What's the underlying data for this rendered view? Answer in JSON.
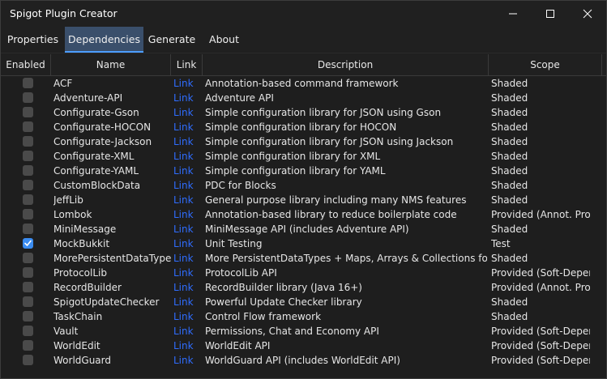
{
  "window": {
    "title": "Spigot Plugin Creator",
    "controls": [
      "minimize",
      "maximize",
      "close"
    ]
  },
  "tabs": [
    {
      "label": "Properties",
      "active": false
    },
    {
      "label": "Dependencies",
      "active": true
    },
    {
      "label": "Generate",
      "active": false
    },
    {
      "label": "About",
      "active": false
    }
  ],
  "table": {
    "columns": {
      "enabled": "Enabled",
      "name": "Name",
      "link": "Link",
      "description": "Description",
      "scope": "Scope"
    },
    "rows": [
      {
        "enabled": false,
        "name": "ACF",
        "link": "Link",
        "description": "Annotation-based command framework",
        "scope": "Shaded"
      },
      {
        "enabled": false,
        "name": "Adventure-API",
        "link": "Link",
        "description": "Adventure API",
        "scope": "Shaded"
      },
      {
        "enabled": false,
        "name": "Configurate-Gson",
        "link": "Link",
        "description": "Simple configuration library for JSON using Gson",
        "scope": "Shaded"
      },
      {
        "enabled": false,
        "name": "Configurate-HOCON",
        "link": "Link",
        "description": "Simple configuration library for HOCON",
        "scope": "Shaded"
      },
      {
        "enabled": false,
        "name": "Configurate-Jackson",
        "link": "Link",
        "description": "Simple configuration library for JSON using Jackson",
        "scope": "Shaded"
      },
      {
        "enabled": false,
        "name": "Configurate-XML",
        "link": "Link",
        "description": "Simple configuration library for XML",
        "scope": "Shaded"
      },
      {
        "enabled": false,
        "name": "Configurate-YAML",
        "link": "Link",
        "description": "Simple configuration library for YAML",
        "scope": "Shaded"
      },
      {
        "enabled": false,
        "name": "CustomBlockData",
        "link": "Link",
        "description": "PDC for Blocks",
        "scope": "Shaded"
      },
      {
        "enabled": false,
        "name": "JeffLib",
        "link": "Link",
        "description": "General purpose library including many NMS features",
        "scope": "Shaded"
      },
      {
        "enabled": false,
        "name": "Lombok",
        "link": "Link",
        "description": "Annotation-based library to reduce boilerplate code",
        "scope": "Provided (Annot. Proc.)"
      },
      {
        "enabled": false,
        "name": "MiniMessage",
        "link": "Link",
        "description": "MiniMessage API (includes Adventure API)",
        "scope": "Shaded"
      },
      {
        "enabled": true,
        "name": "MockBukkit",
        "link": "Link",
        "description": "Unit Testing",
        "scope": "Test"
      },
      {
        "enabled": false,
        "name": "MorePersistentDataTypes",
        "link": "Link",
        "description": "More PersistentDataTypes + Maps, Arrays & Collections for PDC",
        "scope": "Shaded"
      },
      {
        "enabled": false,
        "name": "ProtocolLib",
        "link": "Link",
        "description": "ProtocolLib API",
        "scope": "Provided (Soft-Depend"
      },
      {
        "enabled": false,
        "name": "RecordBuilder",
        "link": "Link",
        "description": "RecordBuilder library (Java 16+)",
        "scope": "Provided (Annot. Proc.)"
      },
      {
        "enabled": false,
        "name": "SpigotUpdateChecker",
        "link": "Link",
        "description": "Powerful Update Checker library",
        "scope": "Shaded"
      },
      {
        "enabled": false,
        "name": "TaskChain",
        "link": "Link",
        "description": "Control Flow framework",
        "scope": "Shaded"
      },
      {
        "enabled": false,
        "name": "Vault",
        "link": "Link",
        "description": "Permissions, Chat and Economy API",
        "scope": "Provided (Soft-Depend"
      },
      {
        "enabled": false,
        "name": "WorldEdit",
        "link": "Link",
        "description": "WorldEdit API",
        "scope": "Provided (Soft-Depend"
      },
      {
        "enabled": false,
        "name": "WorldGuard",
        "link": "Link",
        "description": "WorldGuard API (includes WorldEdit API)",
        "scope": "Provided (Soft-Depend"
      }
    ]
  },
  "colors": {
    "background": "#202020",
    "accent": "#4c9dff",
    "activeTab": "#3a4f6b",
    "link": "#2f6dff",
    "checkboxOn": "#3b8cf0"
  }
}
